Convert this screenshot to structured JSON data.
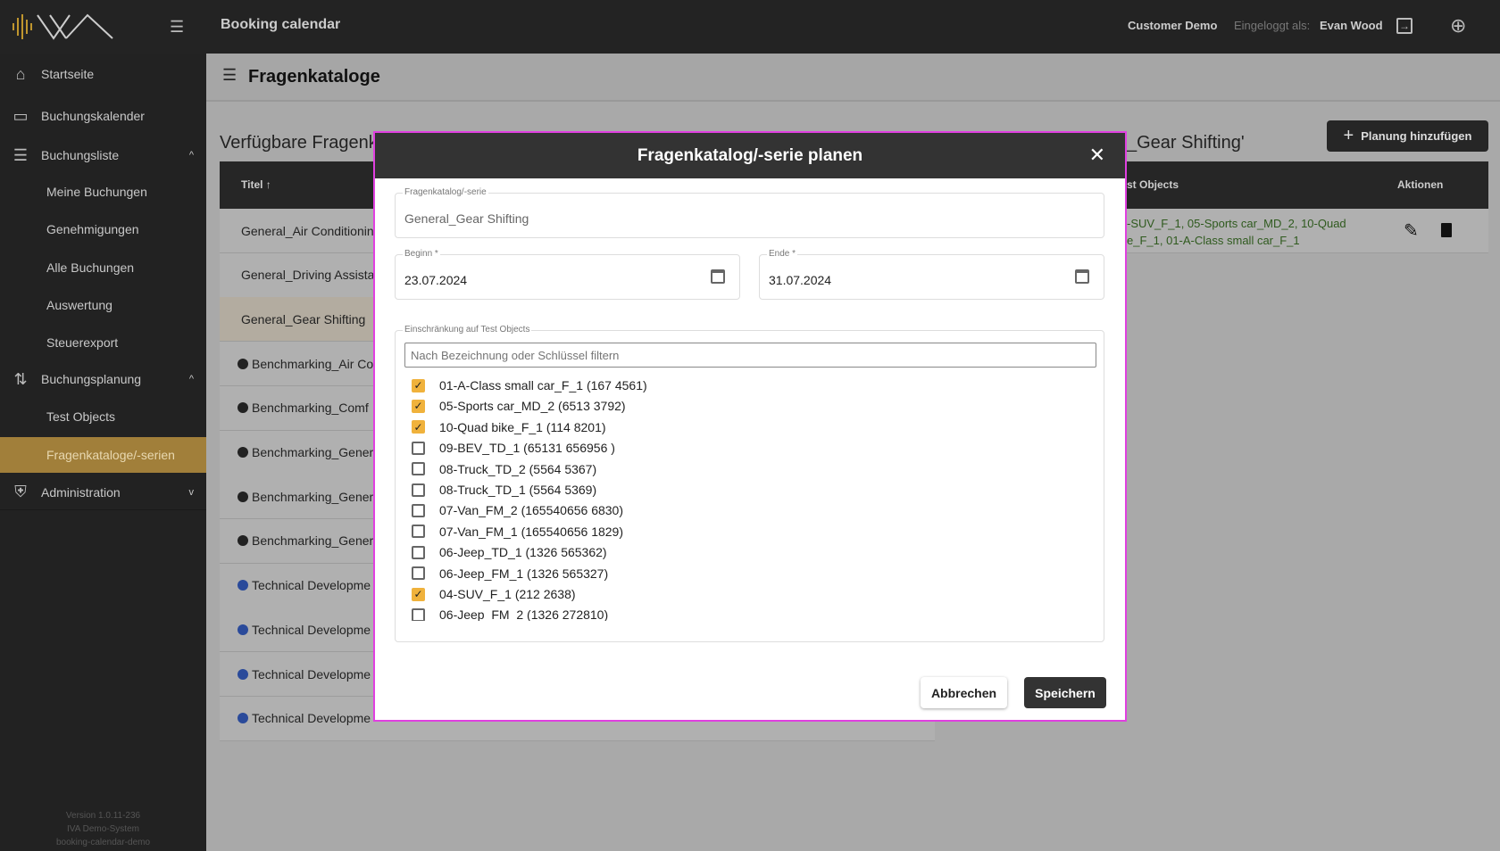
{
  "header": {
    "app_title": "Booking calendar",
    "customer": "Customer Demo",
    "logged_in_label": "Eingeloggt als:",
    "user": "Evan Wood"
  },
  "sidebar": {
    "items": [
      {
        "label": "Startseite",
        "icon": "home-icon"
      },
      {
        "label": "Buchungskalender",
        "icon": "calendar-icon"
      },
      {
        "label": "Buchungsliste",
        "icon": "list-icon",
        "expanded": true
      },
      {
        "label": "Meine Buchungen"
      },
      {
        "label": "Genehmigungen"
      },
      {
        "label": "Alle Buchungen"
      },
      {
        "label": "Auswertung"
      },
      {
        "label": "Steuerexport"
      },
      {
        "label": "Buchungsplanung",
        "icon": "planning-icon",
        "expanded": true
      },
      {
        "label": "Test Objects"
      },
      {
        "label": "Fragenkataloge/-serien",
        "active": true
      },
      {
        "label": "Administration",
        "icon": "shield-icon",
        "expanded": false
      }
    ],
    "version": [
      "Version 1.0.11-236",
      "IVA Demo-System",
      "booking-calendar-demo"
    ],
    "accent": "#a17f3a"
  },
  "page": {
    "title": "Fragenkataloge",
    "left_heading": "Verfügbare Fragenk",
    "right_heading": "_Gear Shifting'",
    "add_button": "Planung hinzufügen",
    "left_table": {
      "header": "Titel",
      "rows": [
        {
          "title": "General_Air Conditioning"
        },
        {
          "title": "General_Driving Assistar"
        },
        {
          "title": "General_Gear Shifting",
          "selected": true
        },
        {
          "title": "Benchmarking_Air Co",
          "dot": "black"
        },
        {
          "title": "Benchmarking_Comf",
          "dot": "black"
        },
        {
          "title": "Benchmarking_Gener",
          "dot": "black"
        },
        {
          "title": "Benchmarking_Gener",
          "dot": "black"
        },
        {
          "title": "Benchmarking_Gener",
          "dot": "black"
        },
        {
          "title": "Technical Developme",
          "dot": "blue"
        },
        {
          "title": "Technical Developme",
          "dot": "blue"
        },
        {
          "title": "Technical Developme",
          "dot": "blue"
        },
        {
          "title": "Technical Developme",
          "dot": "blue"
        }
      ]
    },
    "right_table": {
      "headers": [
        "st Objects",
        "Aktionen"
      ],
      "rows": [
        {
          "objects_line1": "-SUV_F_1, 05-Sports car_MD_2, 10-Quad",
          "objects_line2": "e_F_1, 01-A-Class small car_F_1"
        }
      ]
    }
  },
  "modal": {
    "title": "Fragenkatalog/-serie planen",
    "catalog_label": "Fragenkatalog/-serie",
    "catalog_value": "General_Gear Shifting",
    "start_label": "Beginn *",
    "start_value": "23.07.2024",
    "end_label": "Ende *",
    "end_value": "31.07.2024",
    "restriction_label": "Einschränkung auf Test Objects",
    "filter_placeholder": "Nach Bezeichnung oder Schlüssel filtern",
    "items": [
      {
        "label": "01-A-Class small car_F_1 (167 4561)",
        "checked": true
      },
      {
        "label": "05-Sports car_MD_2 (6513 3792)",
        "checked": true
      },
      {
        "label": "10-Quad bike_F_1 (114 8201)",
        "checked": true
      },
      {
        "label": "09-BEV_TD_1 (65131 656956 )",
        "checked": false
      },
      {
        "label": "08-Truck_TD_2 (5564 5367)",
        "checked": false
      },
      {
        "label": "08-Truck_TD_1 (5564 5369)",
        "checked": false
      },
      {
        "label": "07-Van_FM_2 (165540656 6830)",
        "checked": false
      },
      {
        "label": "07-Van_FM_1 (165540656 1829)",
        "checked": false
      },
      {
        "label": "06-Jeep_TD_1 (1326 565362)",
        "checked": false
      },
      {
        "label": "06-Jeep_FM_1 (1326 565327)",
        "checked": false
      },
      {
        "label": "04-SUV_F_1 (212 2638)",
        "checked": true
      },
      {
        "label": "06-Jeep_FM_2 (1326 272810)",
        "checked": false
      }
    ],
    "cancel": "Abbrechen",
    "save": "Speichern"
  }
}
